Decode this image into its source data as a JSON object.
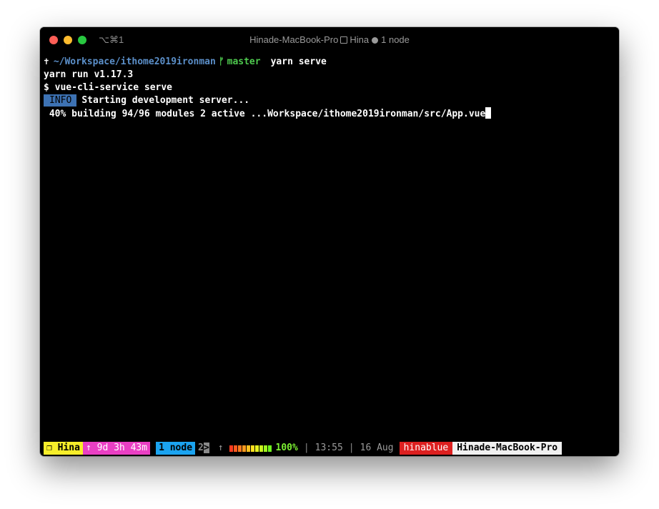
{
  "window": {
    "shortcut": "⌥⌘1",
    "title_host": "Hinade-MacBook-Pro",
    "title_session": "Hina",
    "title_window": "1 node"
  },
  "terminal": {
    "prompt": {
      "symbol": "✝",
      "path": "~/Workspace/ithome2019ironman",
      "branch_icon": "git-branch-icon",
      "branch": "master",
      "command": "yarn serve"
    },
    "lines": {
      "yarn_version": "yarn run v1.17.3",
      "service_cmd": "$ vue-cli-service serve",
      "info_badge": "INFO",
      "info_text": "Starting development server...",
      "progress": " 40% building 94/96 modules 2 active ...Workspace/ithome2019ironman/src/App.vue"
    }
  },
  "statusbar": {
    "session_icon": "window-icon",
    "session": "Hina",
    "uptime": "↑ 9d 3h 43m",
    "window_active": "1 node",
    "window_next_num": "2",
    "window_next_caret": ">",
    "battery_arrow": "↑",
    "battery_percent": "100%",
    "time": "13:55",
    "date": "16 Aug",
    "user": "hinablue",
    "host": "Hinade-MacBook-Pro",
    "separator": "|",
    "battery_colors": [
      "#ff3b1f",
      "#ff5a1f",
      "#ff7a1f",
      "#ff9a1f",
      "#ffc21f",
      "#ffe01f",
      "#e8f51f",
      "#c8f51f",
      "#9ef51f",
      "#6ef51f"
    ]
  }
}
